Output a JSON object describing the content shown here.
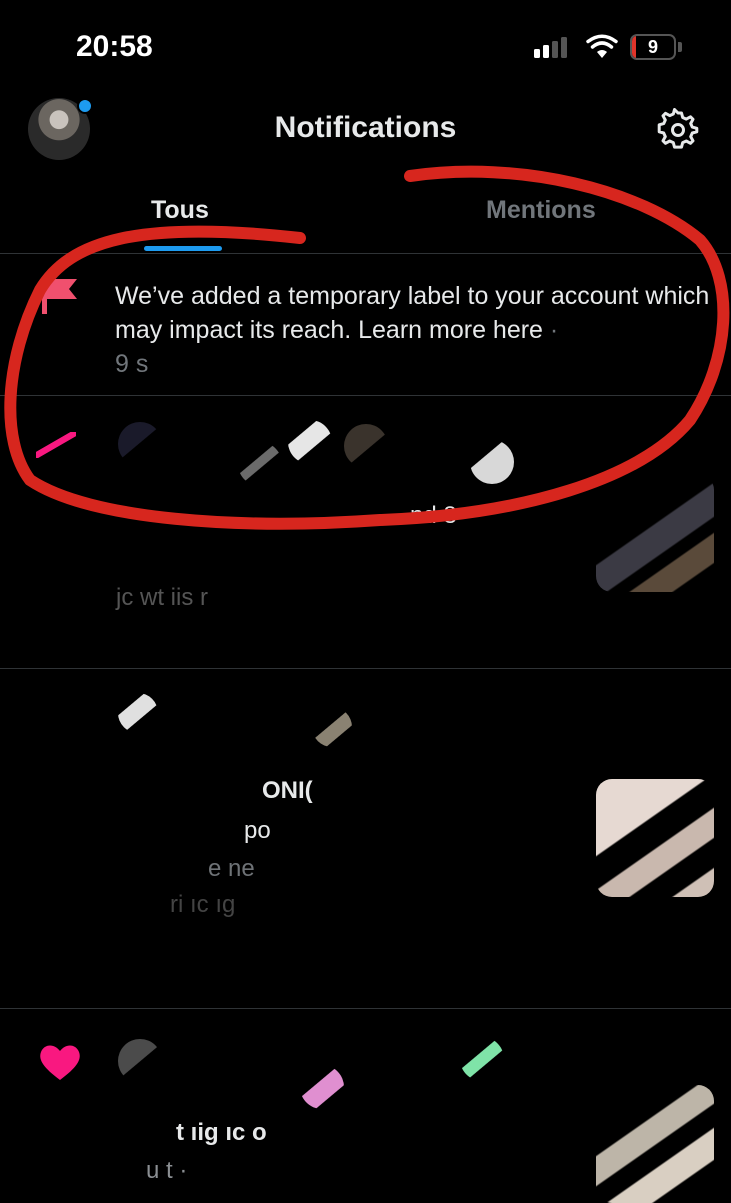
{
  "status_bar": {
    "time": "20:58",
    "battery_level": "9"
  },
  "header": {
    "title": "Notifications"
  },
  "tabs": [
    {
      "label": "Tous",
      "active": true
    },
    {
      "label": "Mentions",
      "active": false
    }
  ],
  "notice": {
    "text": "We’ve added a temporary label to your account which may impact its reach. Learn more here",
    "separator": " · ",
    "time": "9 s"
  },
  "feed_fragments": {
    "group1_count": "nd 8",
    "group1_line": "jc   wt  iis r",
    "group2_name": "ONI(",
    "group2_line1": "po",
    "group2_line2": "e    ne",
    "group2_line3": "ri   ıc  ıg",
    "group3_line1": "t  ıig   ıc   o",
    "group3_line2": "u  t ·"
  },
  "colors": {
    "accent": "#1d9bf0",
    "flag": "#f0506e",
    "like": "#f91880",
    "annotation": "#d7261e"
  },
  "icons": [
    "gear-icon",
    "flag-icon",
    "heart-icon",
    "wifi-icon",
    "signal-icon",
    "battery-icon"
  ]
}
